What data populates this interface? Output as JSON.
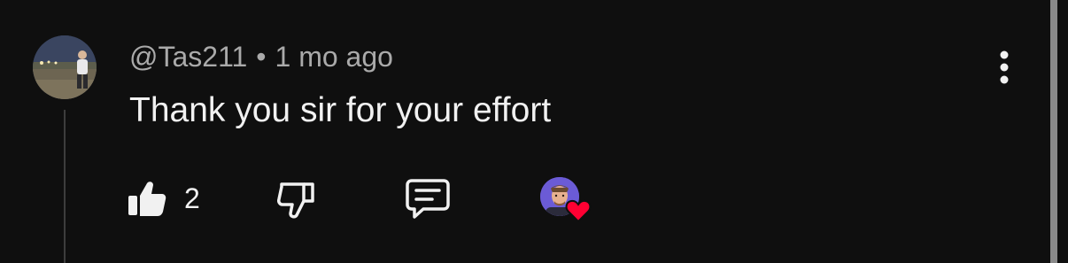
{
  "comment": {
    "author_handle": "@Tas211",
    "separator": "•",
    "time_ago": "1 mo ago",
    "text": "Thank you sir for your effort",
    "like_count": "2"
  },
  "icons": {
    "avatar": "user-avatar",
    "more": "more-vertical-icon",
    "like": "thumb-up-filled-icon",
    "dislike": "thumb-down-outline-icon",
    "reply": "reply-comment-icon",
    "creator_heart": "creator-heart-icon"
  },
  "colors": {
    "background": "#0f0f0f",
    "primary_text": "#f1f1f1",
    "secondary_text": "#aaaaaa",
    "heart": "#ff0033",
    "creator_avatar_bg": "#6b5bd6"
  }
}
